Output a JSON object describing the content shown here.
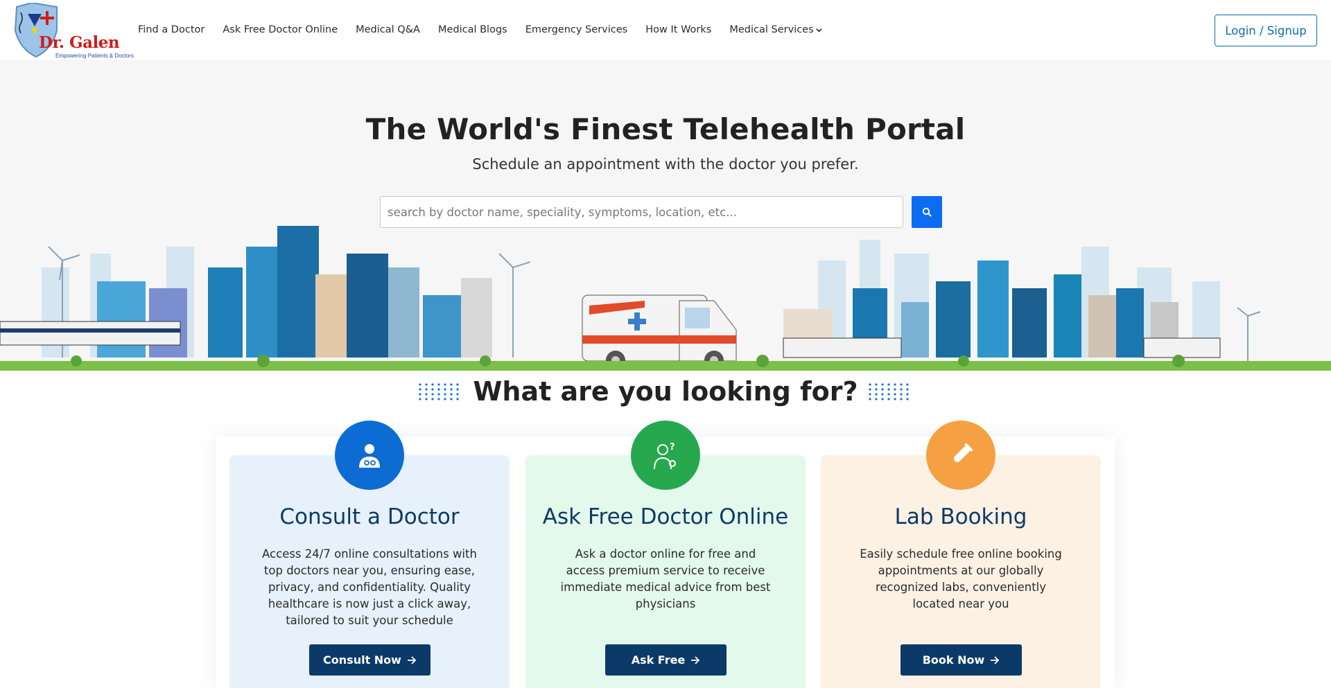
{
  "header": {
    "logo_text": "Dr. Galen",
    "logo_tagline": "Empowering Patients & Doctors",
    "nav": [
      {
        "label": "Find a Doctor"
      },
      {
        "label": "Ask Free Doctor Online"
      },
      {
        "label": "Medical Q&A"
      },
      {
        "label": "Medical Blogs"
      },
      {
        "label": "Emergency Services"
      },
      {
        "label": "How It Works"
      },
      {
        "label": "Medical Services"
      }
    ],
    "login_label": "Login / Signup"
  },
  "hero": {
    "title": "The World's Finest Telehealth Portal",
    "subtitle": "Schedule an appointment with the doctor you prefer.",
    "search_placeholder": "search by doctor name, speciality, symptoms, location, etc..."
  },
  "section": {
    "title": "What are you looking for?"
  },
  "cards": [
    {
      "title": "Consult a Doctor",
      "lines": [
        "Access 24/7 online consultations with",
        "top doctors near you, ensuring ease,",
        "privacy, and confidentiality. Quality",
        "healthcare is now just a click away,",
        "tailored to suit your schedule"
      ],
      "button": "Consult Now",
      "icon": "doctor-icon",
      "color": "#0c6cd4"
    },
    {
      "title": "Ask Free Doctor Online",
      "lines": [
        "Ask a doctor online for free and",
        "access premium service to receive",
        "immediate medical advice from best",
        "physicians"
      ],
      "button": "Ask Free",
      "icon": "doctor-question-icon",
      "color": "#27a84f"
    },
    {
      "title": "Lab Booking",
      "lines": [
        "Easily schedule free online booking",
        "appointments at our globally",
        "recognized labs, conveniently",
        "located near you"
      ],
      "button": "Book Now",
      "icon": "test-tube-icon",
      "color": "#f5a143"
    }
  ],
  "colors": {
    "primary": "#0c3a68",
    "accent_blue": "#0c6cf2",
    "login": "#0e6ba8"
  }
}
